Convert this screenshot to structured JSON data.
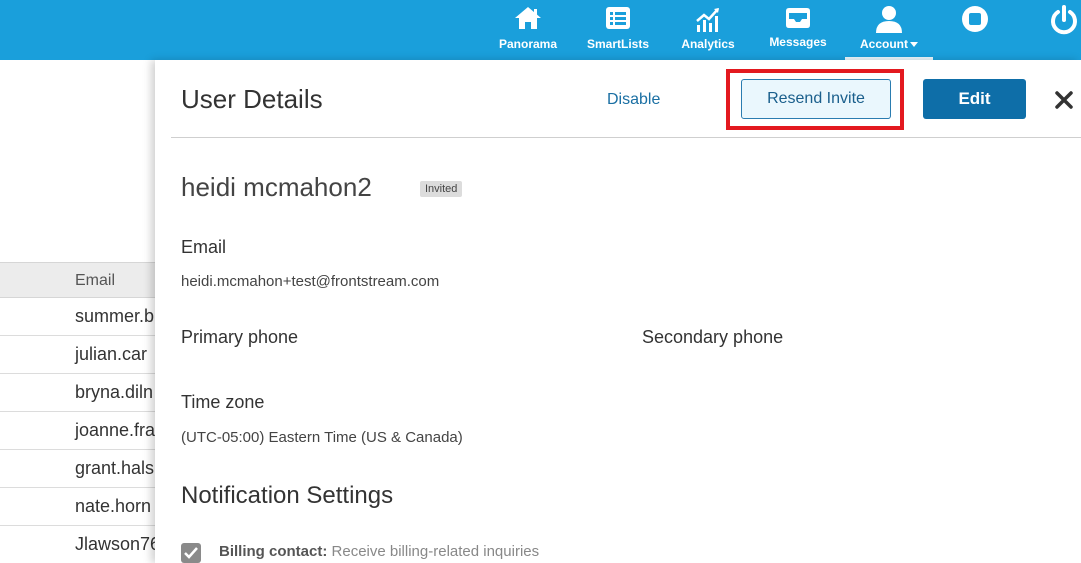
{
  "nav": {
    "items": [
      {
        "label": "Panorama",
        "icon": "home-icon"
      },
      {
        "label": "SmartLists",
        "icon": "list-icon"
      },
      {
        "label": "Analytics",
        "icon": "analytics-icon"
      },
      {
        "label": "Messages",
        "icon": "inbox-icon"
      },
      {
        "label": "Account",
        "icon": "user-icon"
      }
    ],
    "stop_icon": "stop-icon",
    "power_icon": "power-icon"
  },
  "table": {
    "header": "Email",
    "rows": [
      "summer.b",
      "julian.car",
      "bryna.diln",
      "joanne.fra",
      "grant.hals",
      "nate.horn",
      "Jlawson76"
    ]
  },
  "drawer": {
    "title": "User Details",
    "disable_label": "Disable",
    "resend_label": "Resend Invite",
    "edit_label": "Edit",
    "user_name": "heidi mcmahon2",
    "status_badge": "Invited",
    "email_label": "Email",
    "email_value": "heidi.mcmahon+test@frontstream.com",
    "primary_phone_label": "Primary phone",
    "secondary_phone_label": "Secondary phone",
    "timezone_label": "Time zone",
    "timezone_value": "(UTC-05:00) Eastern Time (US & Canada)",
    "notifications_title": "Notification Settings",
    "billing_label": "Billing contact:",
    "billing_desc": "Receive billing-related inquiries"
  },
  "colors": {
    "topbar": "#1a9fdb",
    "primary_button": "#0e6ea8",
    "highlight": "#e3191f"
  }
}
